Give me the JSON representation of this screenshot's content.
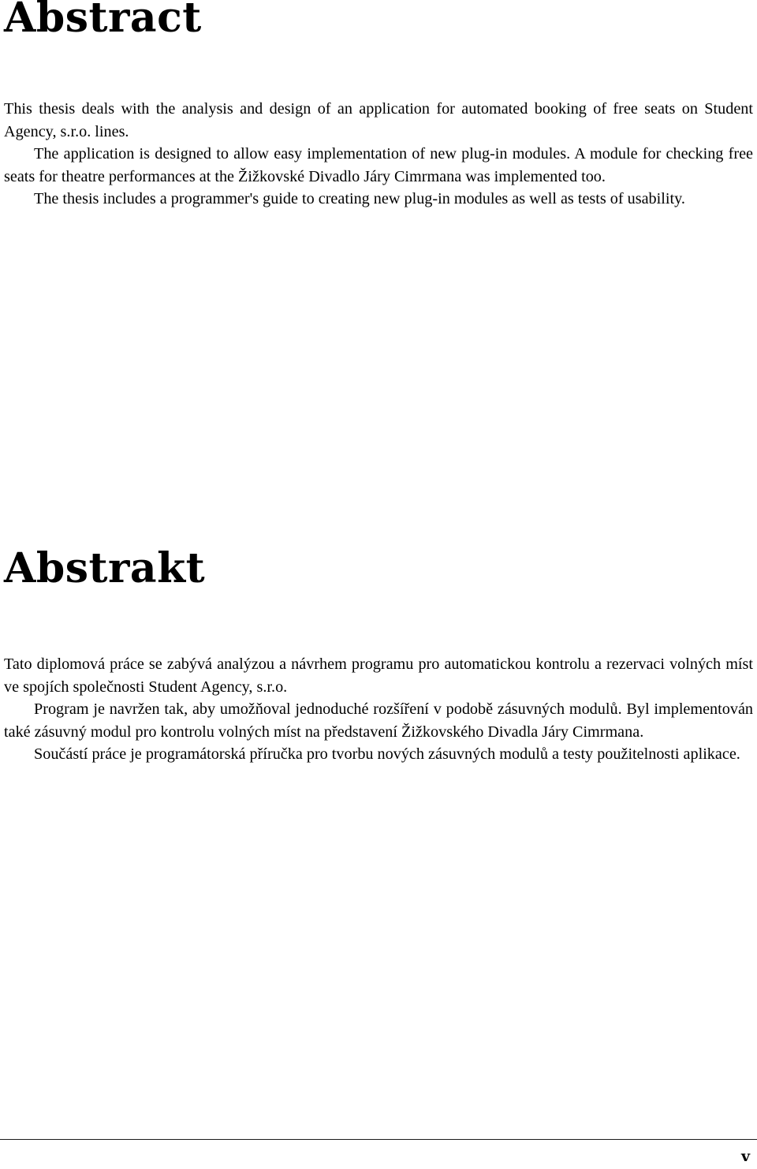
{
  "document": {
    "type": "thesis-front-matter",
    "background_color": "#ffffff",
    "text_color": "#000000"
  },
  "abstract_en": {
    "heading": "Abstract",
    "paragraphs": [
      "This thesis deals with the analysis and design of an application for automated booking of free seats on Student Agency, s.r.o. lines.",
      "The application is designed to allow easy implementation of new plug-in modules. A module for checking free seats for theatre performances at the Žižkovské Divadlo Járy Cimrmana was implemented too.",
      "The thesis includes a programmer's guide to creating new plug-in modules as well as tests of usability."
    ]
  },
  "abstract_cs": {
    "heading": "Abstrakt",
    "paragraphs": [
      "Tato diplomová práce se zabývá analýzou a návrhem programu pro automatickou kontrolu a rezervaci volných míst ve spojích společnosti Student Agency, s.r.o.",
      "Program je navržen tak, aby umožňoval jednoduché rozšíření v podobě zásuvných modulů. Byl implementován také zásuvný modul pro kontrolu volných míst na představení Žižkovského Divadla Járy Cimrmana.",
      "Součástí práce je programátorská příručka pro tvorbu nových zásuvných modulů a testy použitelnosti aplikace."
    ]
  },
  "footer": {
    "page_number": "v",
    "rule_color": "#1a1a1a"
  }
}
